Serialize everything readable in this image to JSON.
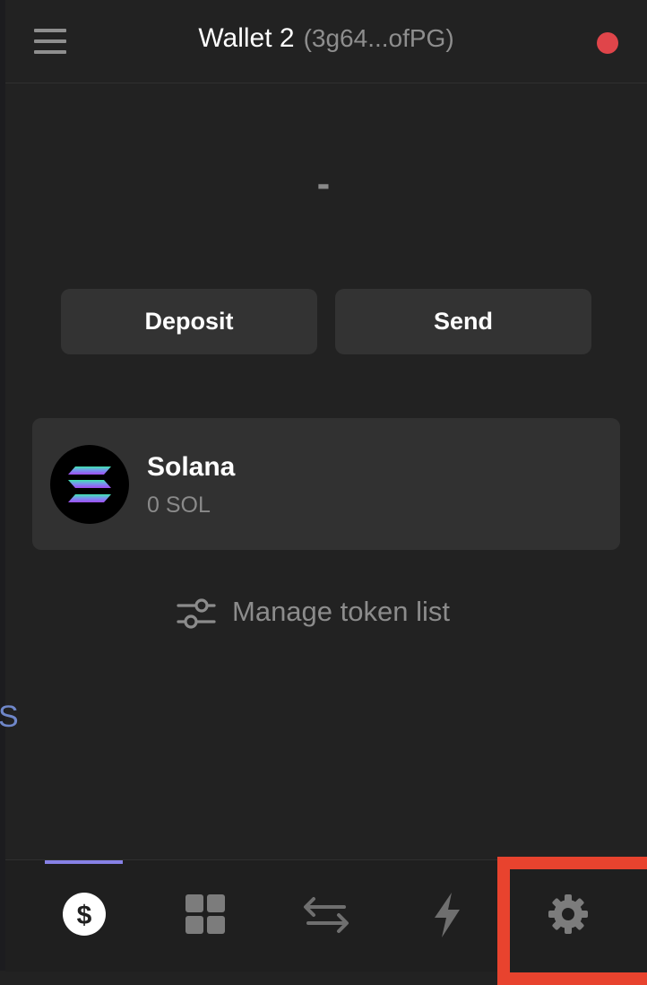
{
  "header": {
    "wallet_name": "Wallet 2",
    "wallet_address": "(3g64...ofPG)",
    "status_color": "#e0454a",
    "menu_icon": "hamburger-menu-icon"
  },
  "balance": {
    "display": "-"
  },
  "actions": {
    "deposit_label": "Deposit",
    "send_label": "Send"
  },
  "tokens": [
    {
      "name": "Solana",
      "amount": "0 SOL",
      "icon": "solana-logo-icon"
    }
  ],
  "manage": {
    "label": "Manage token list",
    "icon": "sliders-icon"
  },
  "bottom_nav": {
    "items": [
      {
        "name": "balances",
        "icon": "dollar-icon",
        "active": true
      },
      {
        "name": "apps",
        "icon": "grid-icon",
        "active": false
      },
      {
        "name": "swap",
        "icon": "swap-arrows-icon",
        "active": false
      },
      {
        "name": "activity",
        "icon": "lightning-icon",
        "active": false
      },
      {
        "name": "settings",
        "icon": "gear-icon",
        "active": false
      }
    ],
    "active_color": "#8781e6",
    "highlight_color": "#e8432e"
  }
}
